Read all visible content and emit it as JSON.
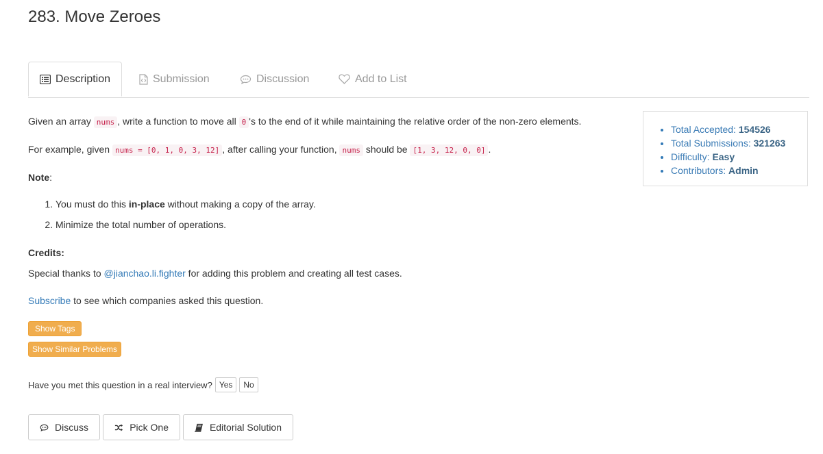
{
  "problem": {
    "title": "283. Move Zeroes"
  },
  "tabs": [
    {
      "label": "Description",
      "icon": "description-icon"
    },
    {
      "label": "Submission",
      "icon": "submission-icon"
    },
    {
      "label": "Discussion",
      "icon": "discussion-icon"
    },
    {
      "label": "Add to List",
      "icon": "heart-icon"
    }
  ],
  "description": {
    "p1_a": "Given an array ",
    "p1_code1": "nums",
    "p1_b": ", write a function to move all ",
    "p1_code2": "0",
    "p1_c": "'s to the end of it while maintaining the relative order of the non-zero elements.",
    "p2_a": "For example, given ",
    "p2_code1": "nums = [0, 1, 0, 3, 12]",
    "p2_b": ", after calling your function, ",
    "p2_code2": "nums",
    "p2_c": " should be ",
    "p2_code3": "[1, 3, 12, 0, 0]",
    "p2_d": ".",
    "note_label": "Note",
    "note_colon": ":",
    "note1_a": "You must do this ",
    "note1_bold": "in-place",
    "note1_b": " without making a copy of the array.",
    "note2": "Minimize the total number of operations.",
    "credits_label": "Credits:",
    "credits_a": "Special thanks to ",
    "credits_link": "@jianchao.li.fighter",
    "credits_b": " for adding this problem and creating all test cases.",
    "subscribe_link": "Subscribe",
    "subscribe_text": " to see which companies asked this question."
  },
  "buttons": {
    "show_tags": "Show Tags",
    "show_similar": "Show Similar Problems",
    "yes": "Yes",
    "no": "No",
    "discuss": "Discuss",
    "pick_one": "Pick One",
    "editorial": "Editorial Solution"
  },
  "interview": {
    "question": "Have you met this question in a real interview?"
  },
  "stats": {
    "accepted_label": "Total Accepted: ",
    "accepted_value": "154526",
    "submissions_label": "Total Submissions: ",
    "submissions_value": "321263",
    "difficulty_label": "Difficulty: ",
    "difficulty_value": "Easy",
    "contributors_label": "Contributors: ",
    "contributors_value": "Admin"
  },
  "colors": {
    "accent": "#337ab7",
    "warning": "#f0ad4e",
    "code_text": "#c7254e",
    "code_bg": "#f9f2f4"
  }
}
